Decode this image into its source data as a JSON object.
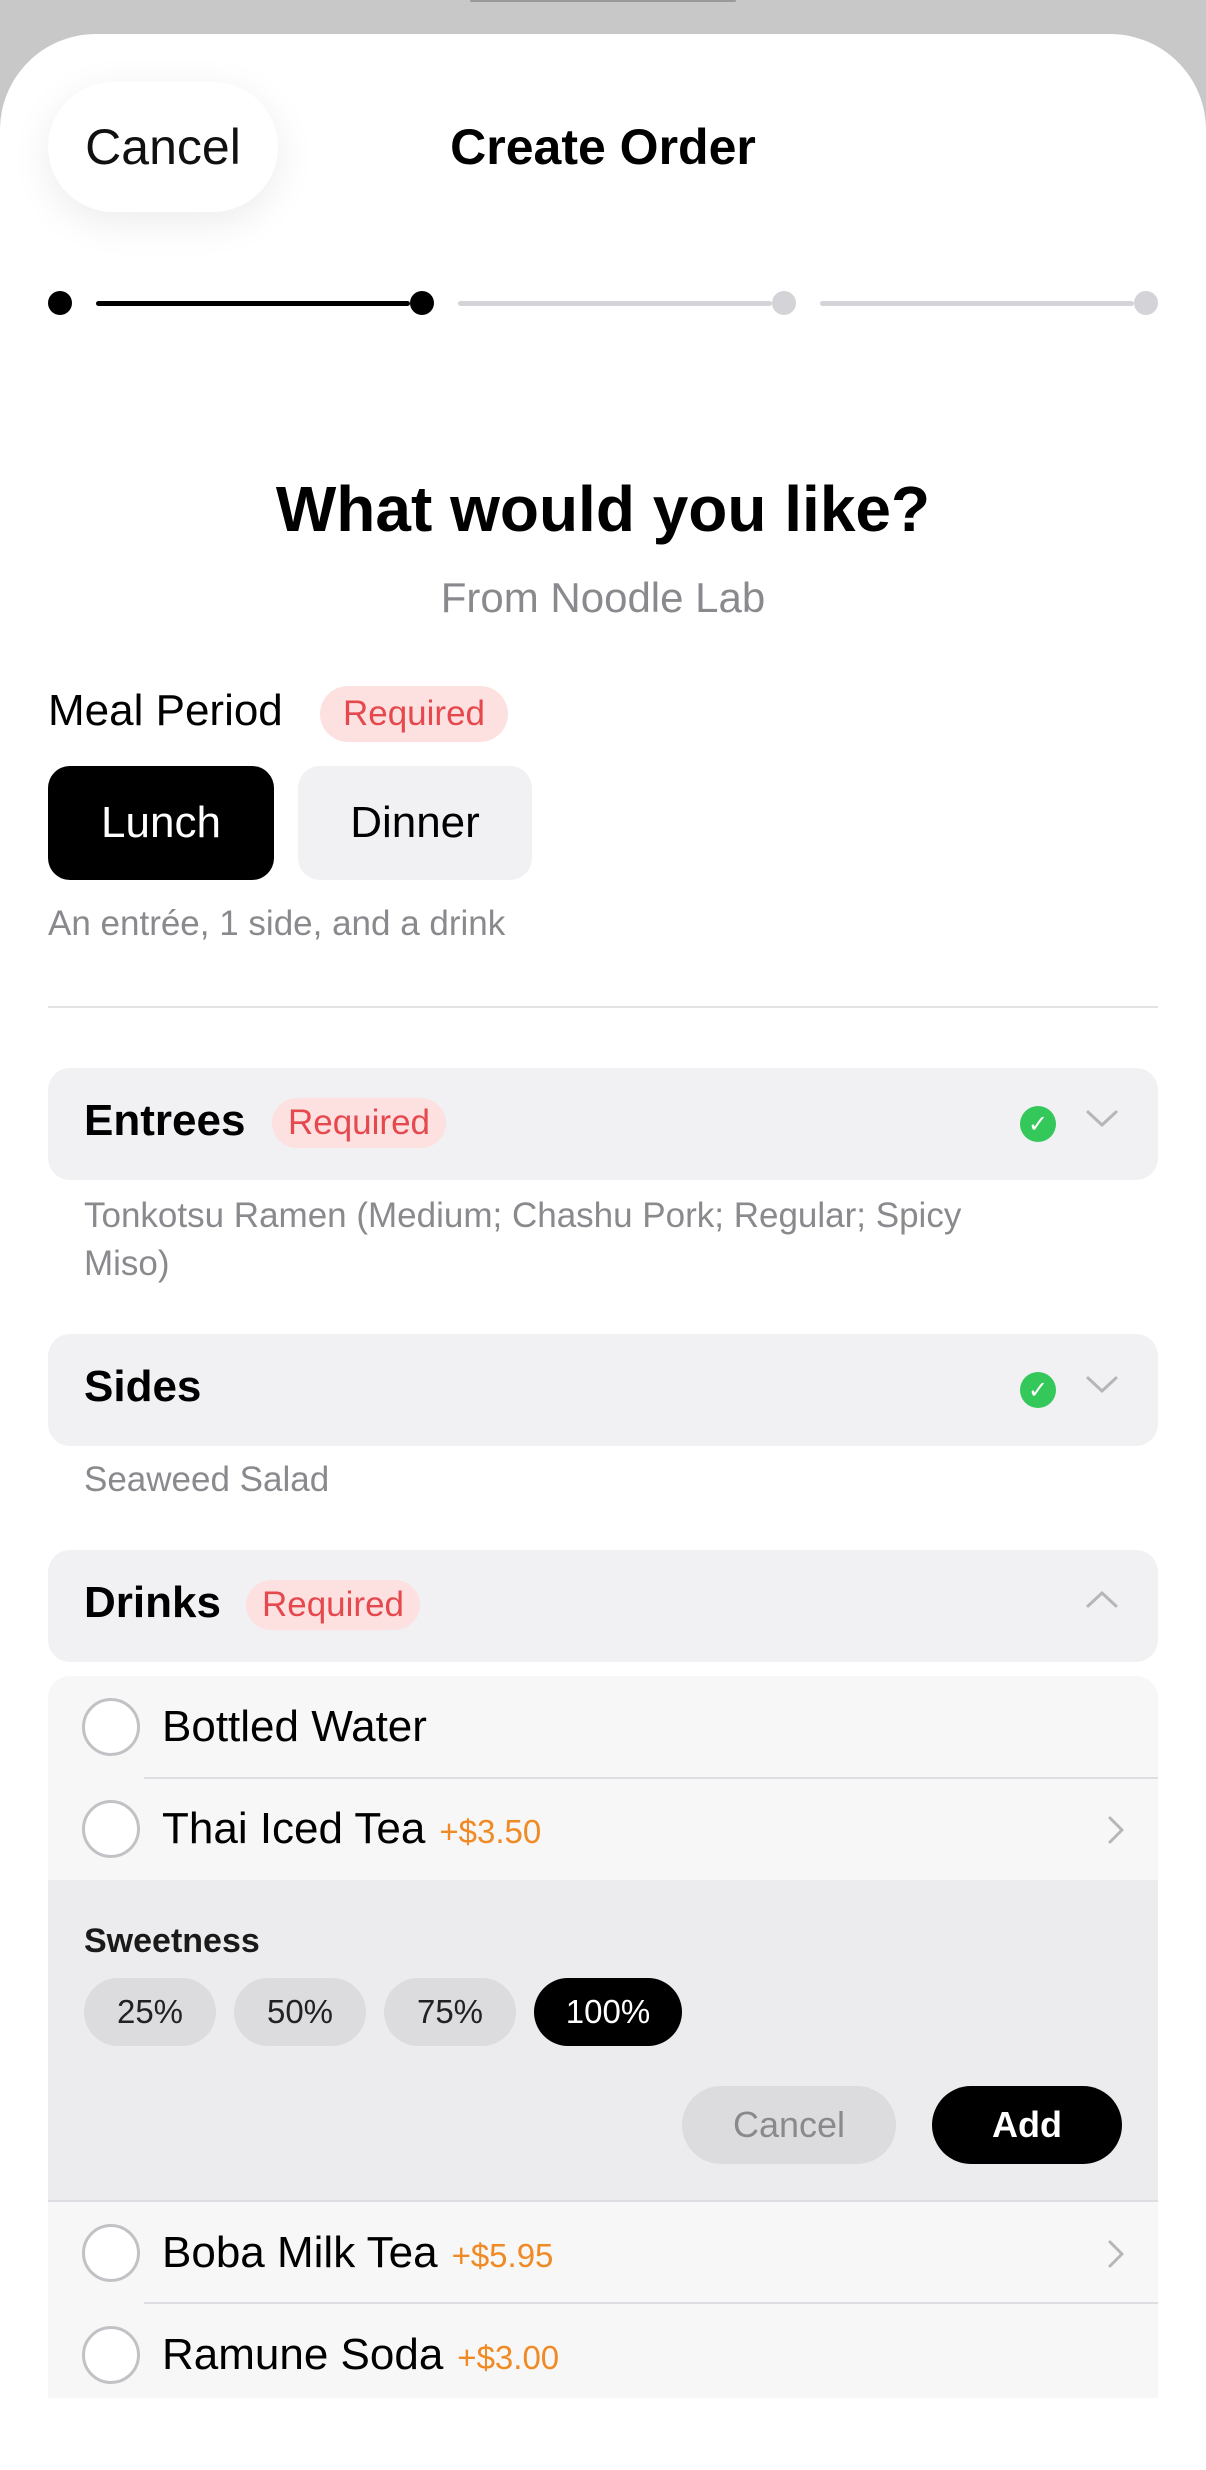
{
  "header": {
    "cancel_label": "Cancel",
    "title": "Create Order",
    "progress": {
      "total_steps": 4,
      "current_step": 2
    }
  },
  "intro": {
    "heading": "What would you like?",
    "subheading": "From Noodle Lab"
  },
  "meal_period": {
    "label": "Meal Period",
    "badge": "Required",
    "options": [
      "Lunch",
      "Dinner"
    ],
    "selected": "Lunch",
    "caption": "An entrée, 1 side, and a drink"
  },
  "sections": {
    "entrees": {
      "title": "Entrees",
      "badge": "Required",
      "summary": "Tonkotsu Ramen (Medium; Chashu Pork; Regular; Spicy Miso)",
      "complete": true
    },
    "sides": {
      "title": "Sides",
      "summary": "Seaweed Salad",
      "complete": true
    },
    "drinks": {
      "title": "Drinks",
      "badge": "Required",
      "expanded": true,
      "items": [
        {
          "name": "Bottled Water",
          "price": ""
        },
        {
          "name": "Thai Iced Tea",
          "price": "+$3.50"
        },
        {
          "name": "Boba Milk Tea",
          "price": "+$5.95"
        },
        {
          "name": "Ramune Soda",
          "price": "+$3.00"
        }
      ],
      "options_pane": {
        "label": "Sweetness",
        "choices": [
          "25%",
          "50%",
          "75%",
          "100%"
        ],
        "selected": "100%",
        "cancel_label": "Cancel",
        "add_label": "Add"
      }
    }
  },
  "colors": {
    "accent": "#000000",
    "required_text": "#e5484d",
    "required_bg": "#fde1e1",
    "price": "#f08a24",
    "check": "#34c759"
  },
  "icons": {
    "check": "checkmark-circle-icon",
    "chevron_down": "chevron-down-icon",
    "chevron_up": "chevron-up-icon",
    "chevron_right": "chevron-right-icon"
  }
}
